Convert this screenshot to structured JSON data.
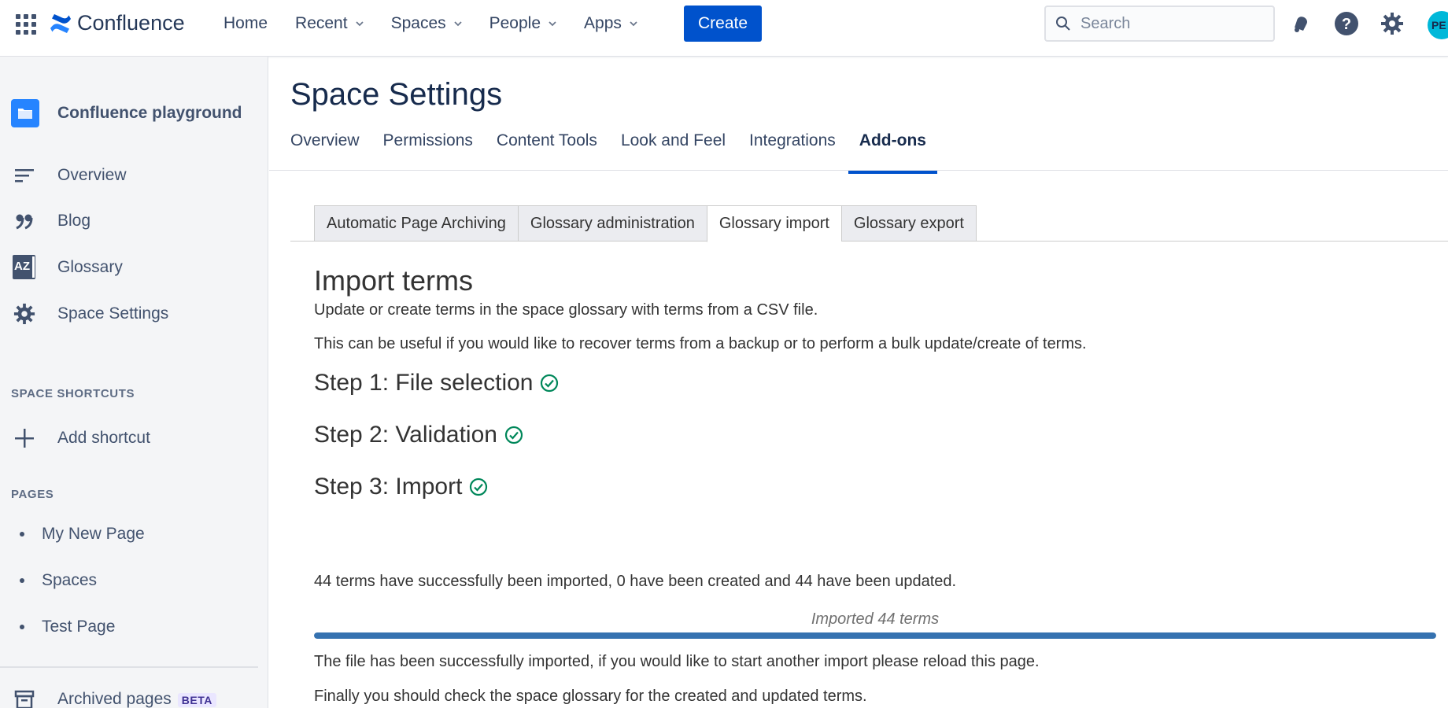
{
  "topbar": {
    "logo_text": "Confluence",
    "nav": [
      "Home",
      "Recent",
      "Spaces",
      "People",
      "Apps"
    ],
    "create_label": "Create",
    "search_placeholder": "Search",
    "avatar_initials": "PE"
  },
  "sidebar": {
    "space_name": "Confluence playground",
    "items": [
      {
        "label": "Overview",
        "icon": "overview-lines-icon"
      },
      {
        "label": "Blog",
        "icon": "quote-icon"
      },
      {
        "label": "Glossary",
        "icon": "az-glossary-icon"
      },
      {
        "label": "Space Settings",
        "icon": "gear-icon"
      }
    ],
    "shortcuts_label": "SPACE SHORTCUTS",
    "add_shortcut": "Add shortcut",
    "pages_label": "PAGES",
    "pages": [
      "My New Page",
      "Spaces",
      "Test Page"
    ],
    "archived_label": "Archived pages",
    "beta_badge": "BETA"
  },
  "main": {
    "title": "Space Settings",
    "tabs": [
      "Overview",
      "Permissions",
      "Content Tools",
      "Look and Feel",
      "Integrations",
      "Add-ons"
    ],
    "active_tab": "Add-ons",
    "addon_tabs": [
      "Automatic Page Archiving",
      "Glossary administration",
      "Glossary import",
      "Glossary export"
    ],
    "active_addon_tab": "Glossary import"
  },
  "import": {
    "heading": "Import terms",
    "desc1": "Update or create terms in the space glossary with terms from a CSV file.",
    "desc2": "This can be useful if you would like to recover terms from a backup or to perform a bulk update/create of terms.",
    "step1": "Step 1: File selection",
    "step2": "Step 2: Validation",
    "step3": "Step 3: Import",
    "result": "44 terms have successfully been imported, 0 have been created and 44 have been updated.",
    "progress_label": "Imported 44 terms",
    "progress_fraction": 1.0,
    "done1": "The file has been successfully imported, if you would like to start another import please reload this page.",
    "done2": "Finally you should check the space glossary for the created and updated terms."
  },
  "colors": {
    "primary": "#0052cc",
    "success": "#00875a",
    "progress": "#3572b0"
  }
}
